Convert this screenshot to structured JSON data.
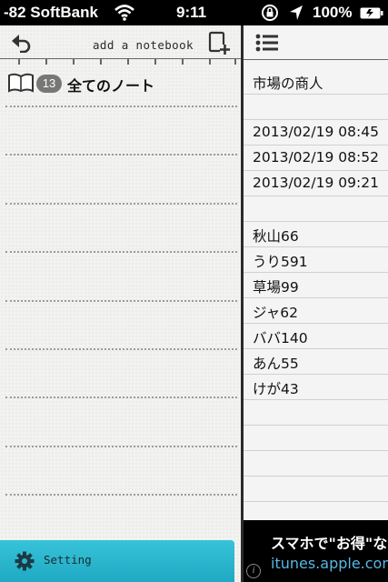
{
  "status_bar": {
    "carrier": "-82 SoftBank",
    "time": "9:11",
    "battery_percent": "100%"
  },
  "left_pane": {
    "add_notebook_label": "add a notebook",
    "all_notes": {
      "count": "13",
      "label": "全てのノート"
    },
    "setting_label": "Setting",
    "setting_color": "#2ab6cd"
  },
  "right_pane": {
    "lines": [
      "市場の商人",
      "",
      "2013/02/19 08:45",
      "2013/02/19 08:52",
      "2013/02/19 09:21",
      "",
      "秋山66",
      "うり591",
      "草場99",
      "ジャ62",
      "ババ140",
      "あん55",
      "けが43"
    ]
  },
  "ad": {
    "title": "スマホで\"お得\"な",
    "url": "itunes.apple.com"
  },
  "icons": {
    "back": "back-arrow-icon",
    "add_notebook": "add-notebook-icon",
    "list": "list-icon",
    "book": "book-icon",
    "gear": "gear-icon",
    "info": "info-icon"
  }
}
